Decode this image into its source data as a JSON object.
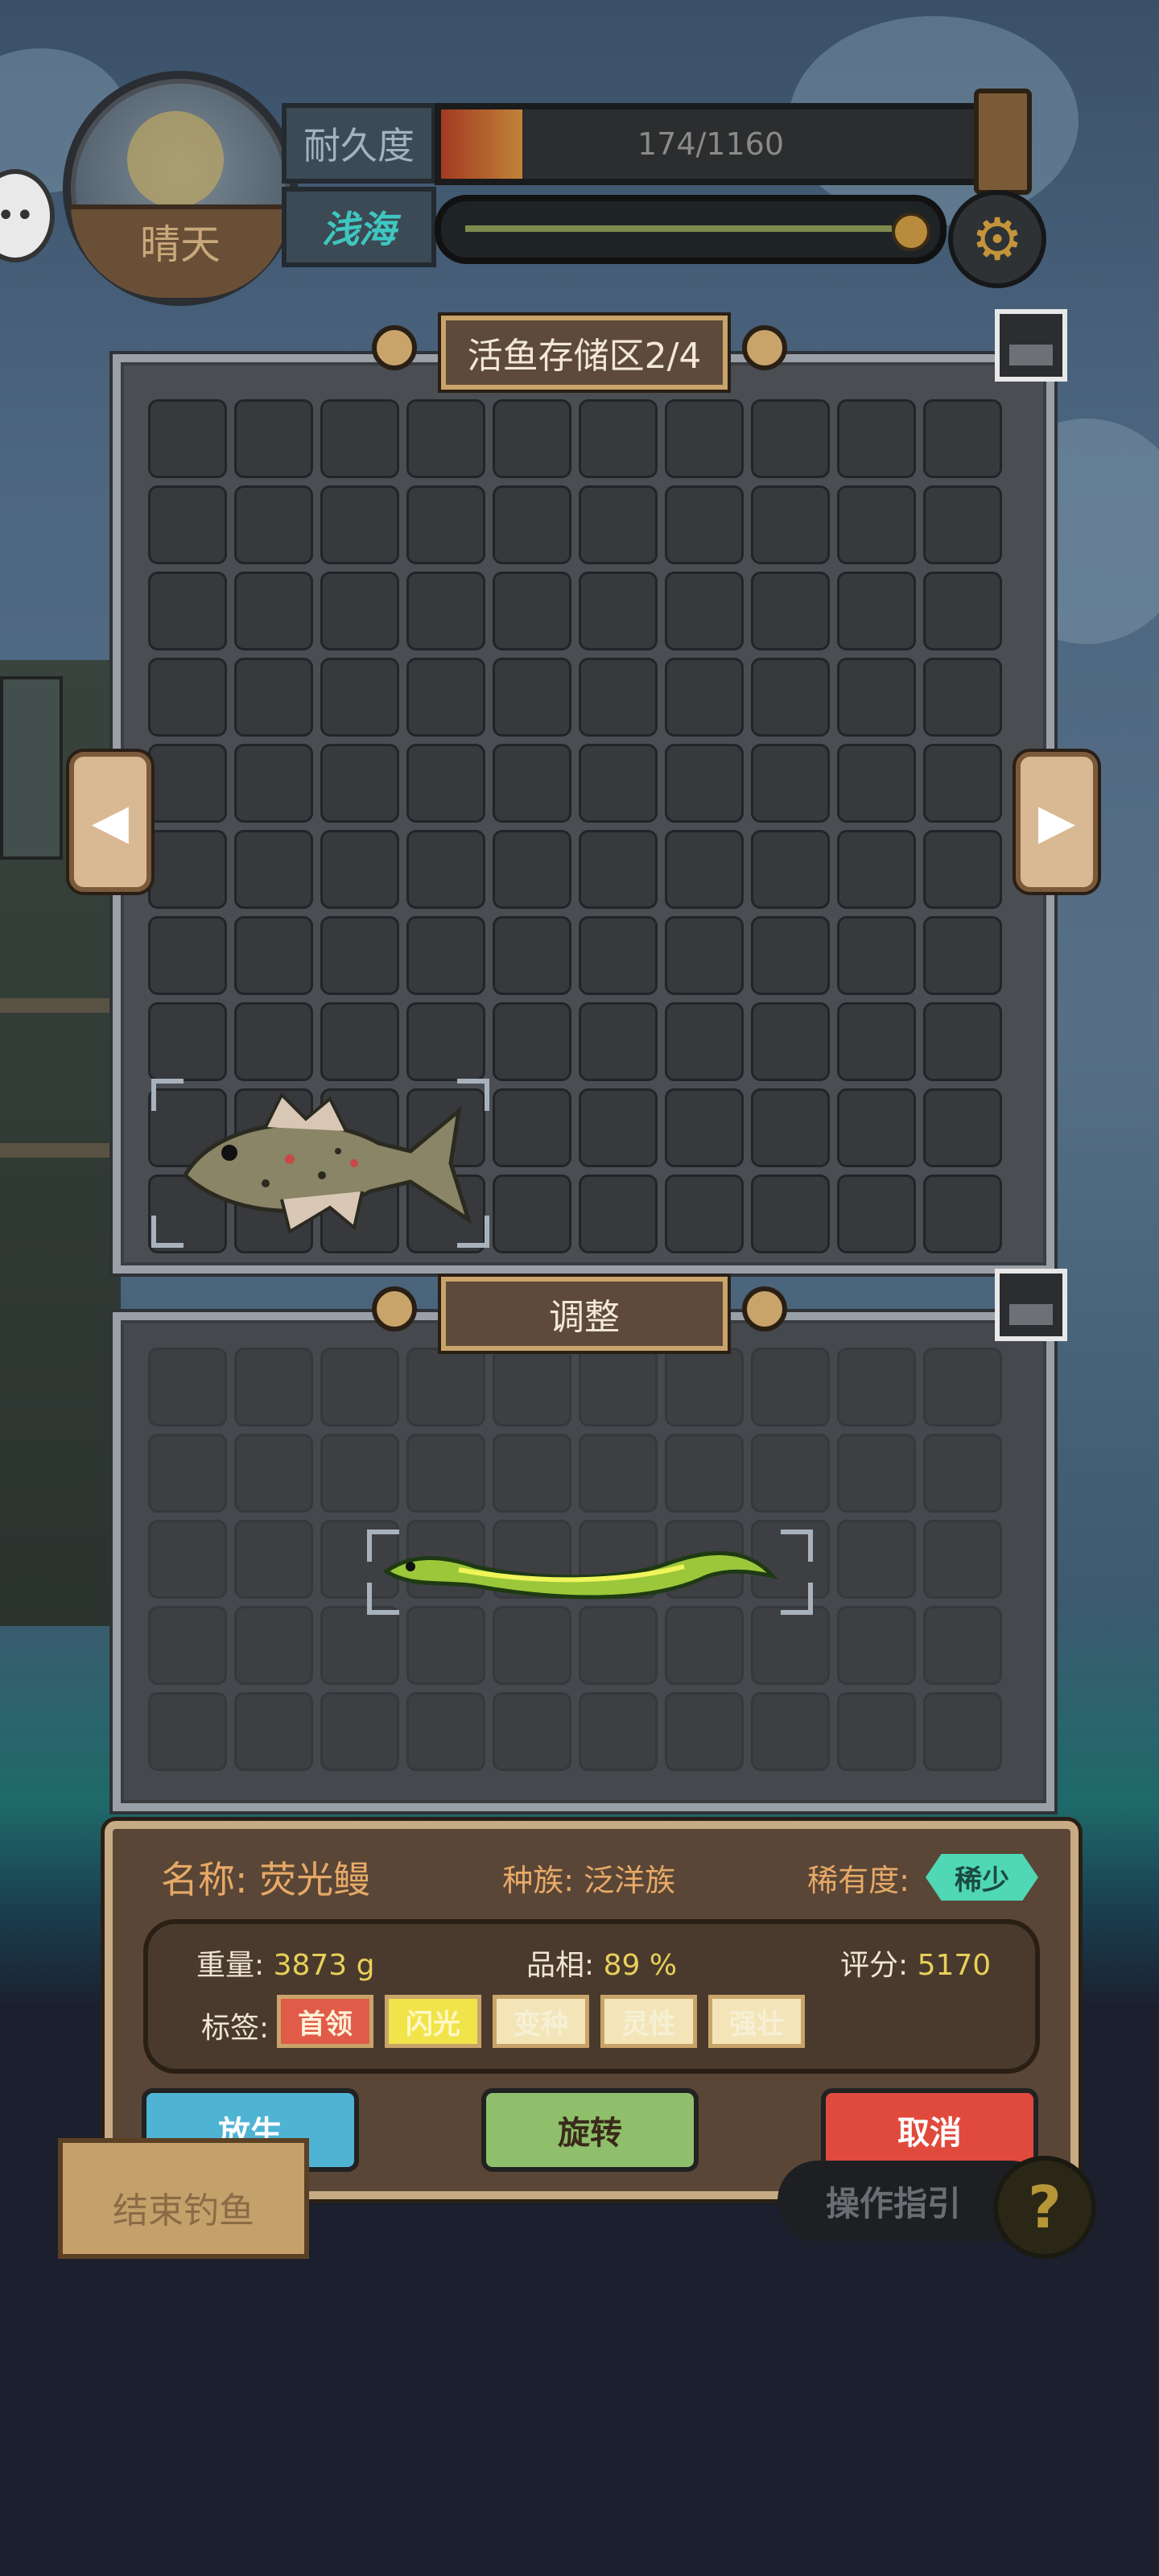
{
  "hud": {
    "weather": "晴天",
    "durability_label": "耐久度",
    "durability_text": "174/1160",
    "durability_value": 174,
    "durability_max": 1160,
    "sea_label": "浅海",
    "settings_icon": "gear-icon"
  },
  "storage": {
    "title": "活鱼存储区2/4",
    "columns": 10,
    "rows": 10,
    "fish_icon": "spotted-fish-icon"
  },
  "adjust": {
    "title": "调整",
    "columns": 10,
    "rows": 5,
    "fish_icon": "glowing-eel-icon"
  },
  "fish": {
    "name_label": "名称:",
    "name": "荧光鳗",
    "race_label": "种族:",
    "race": "泛洋族",
    "rarity_label": "稀有度:",
    "rarity": "稀少",
    "weight_label": "重量:",
    "weight": "3873",
    "weight_unit": "g",
    "quality_label": "品相:",
    "quality": "89",
    "quality_unit": "%",
    "score_label": "评分:",
    "score": "5170",
    "tags_label": "标签:",
    "tags": [
      "首领",
      "闪光",
      "变种",
      "灵性",
      "强壮"
    ]
  },
  "actions": {
    "release": "放生",
    "rotate": "旋转",
    "cancel": "取消"
  },
  "bottom": {
    "end_fishing": "结束钓鱼",
    "guide": "操作指引",
    "help": "?"
  },
  "colors": {
    "rarity_badge": "#4fd7b6",
    "release_button": "#4fb3d4",
    "rotate_button": "#8fbf6b",
    "cancel_button": "#e04a3d"
  }
}
